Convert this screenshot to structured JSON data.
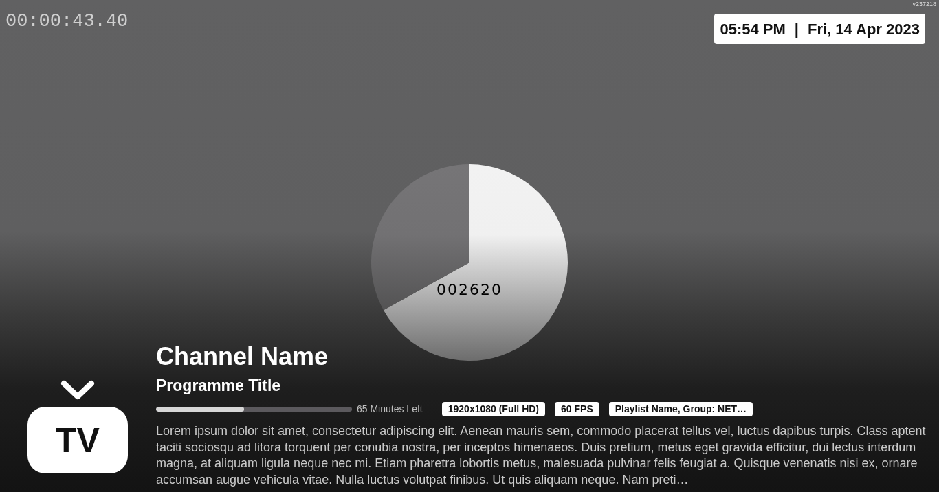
{
  "video": {
    "timecode": "00:00:43.40",
    "frame_counter": "002620"
  },
  "version": "v237218",
  "clock": {
    "time": "05:54 PM",
    "separator": "|",
    "date": "Fri, 14 Apr 2023"
  },
  "logo": {
    "text": "TV"
  },
  "channel": {
    "name": "Channel Name",
    "programme_title": "Programme Title",
    "progress": {
      "level": 0.45,
      "label": "65 Minutes Left"
    },
    "badges": [
      "1920x1080 (Full HD)",
      "60 FPS",
      "Playlist Name, Group: NET…"
    ],
    "description": "Lorem ipsum dolor sit amet, consectetur adipiscing elit. Aenean mauris sem, commodo placerat tellus vel, luctus dapibus turpis. Class aptent taciti sociosqu ad litora torquent per conubia nostra, per inceptos himenaeos. Duis pretium, metus eget gravida efficitur, dui lectus interdum magna, at aliquam ligula neque nec mi. Etiam pharetra lobortis metus, malesuada pulvinar felis feugiat a. Quisque venenatis nisi ex, ornare accumsan augue vehicula vitae. Nulla luctus volutpat finibus. Ut quis aliquam neque. Nam preti…"
  }
}
